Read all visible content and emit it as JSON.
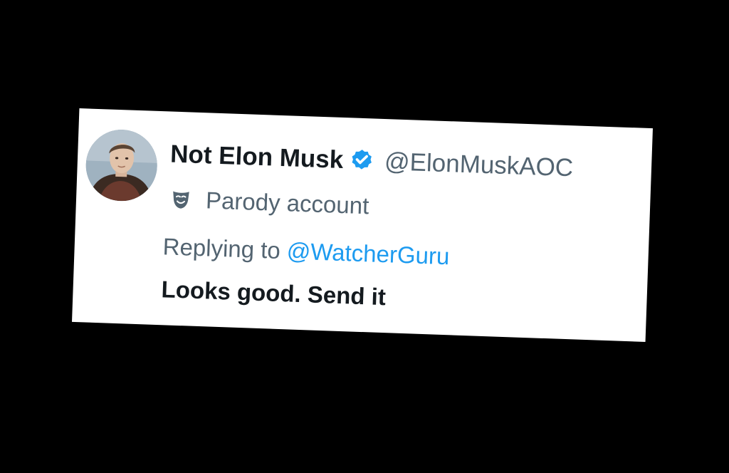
{
  "tweet": {
    "display_name": "Not Elon Musk",
    "handle": "@ElonMuskAOC",
    "verified": true,
    "label": "Parody account",
    "reply_prefix": "Replying to",
    "reply_to": "@WatcherGuru",
    "text": "Looks good. Send it"
  },
  "icons": {
    "verified": "verified-badge-icon",
    "label": "theater-mask-icon"
  },
  "colors": {
    "background": "#000000",
    "card": "#ffffff",
    "name_text": "#141a1f",
    "secondary_text": "#536471",
    "link": "#1d9bf0",
    "verified_badge": "#1d9bf0"
  }
}
